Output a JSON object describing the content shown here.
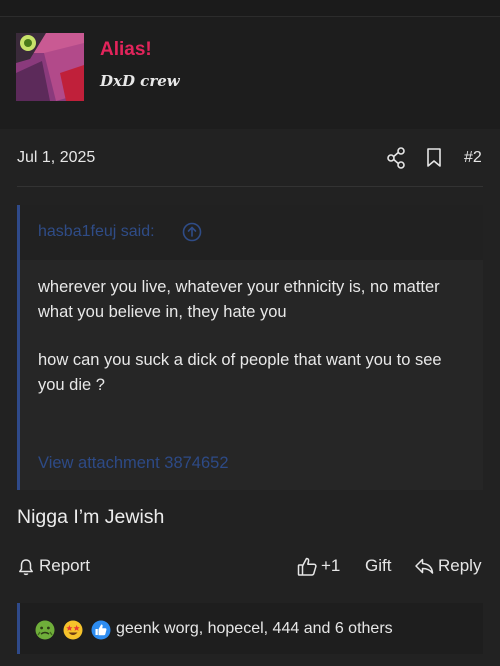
{
  "user": {
    "name": "Alias!",
    "title": "DxD crew"
  },
  "post": {
    "date": "Jul 1, 2025",
    "number": "#2",
    "text": "Nigga I’m Jewish"
  },
  "quote": {
    "author": "hasba1feuj said:",
    "paragraphs": [
      "wherever you live, whatever your ethnicity is, no matter what you believe in, they hate you",
      "how can you suck a dick of people that want you to see you die ?"
    ],
    "attachment": "View attachment 3874652"
  },
  "actions": {
    "report": "Report",
    "like": "+1",
    "gift": "Gift",
    "reply": "Reply"
  },
  "reactions": {
    "icons": [
      "sick-face",
      "star-struck-face",
      "thumbs-up"
    ],
    "summary": "geenk worg, hopecel, 444 and 6 others"
  },
  "colors": {
    "username": "#e2245b",
    "quote_bar": "#2f4a8a",
    "link": "#2f4c87"
  }
}
